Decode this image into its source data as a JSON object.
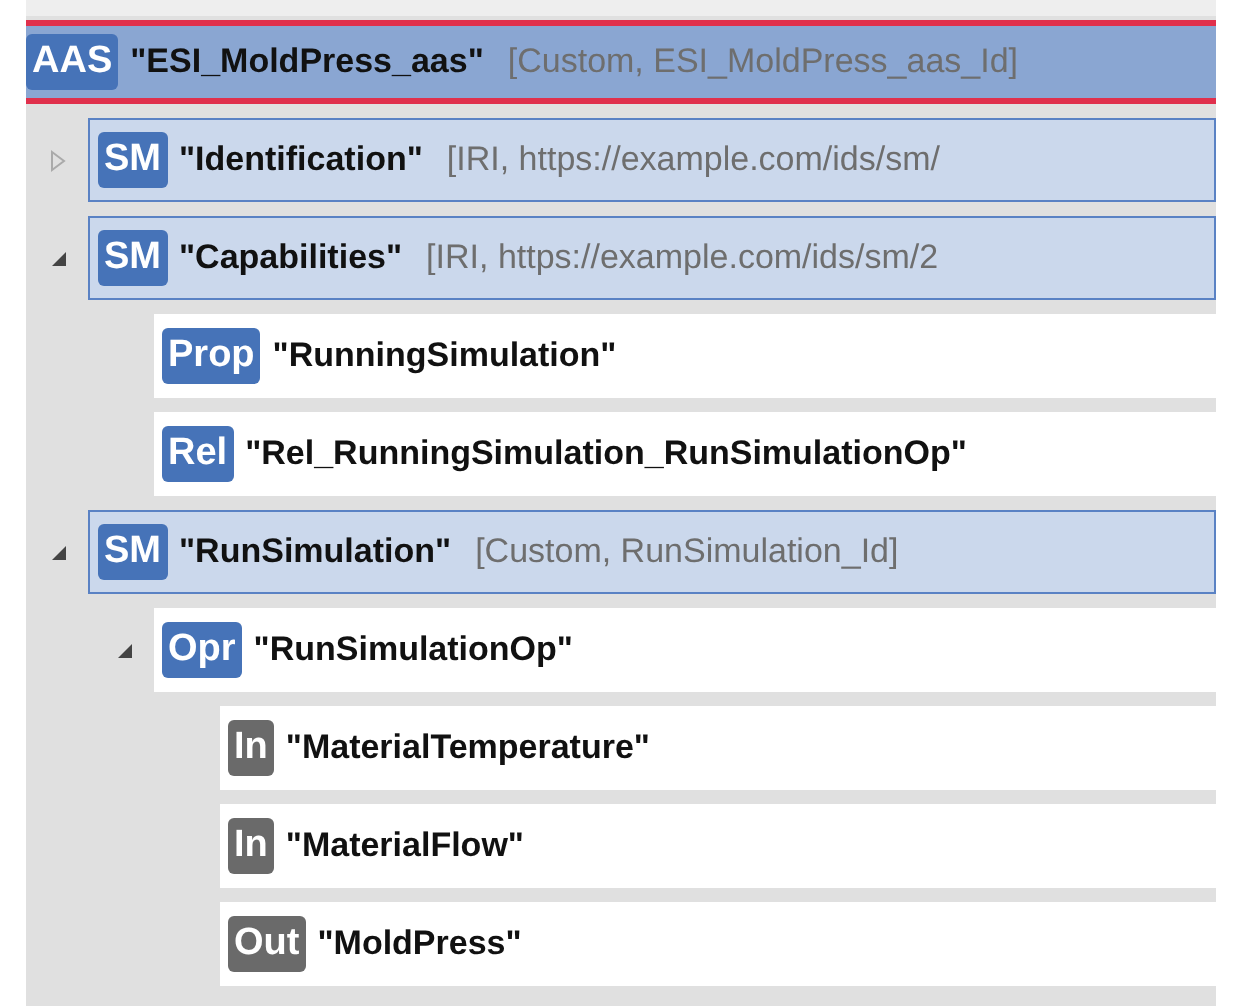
{
  "tree": [
    {
      "kind": "aas",
      "badge": "AAS",
      "name": "\"ESI_MoldPress_aas\"",
      "info": "[Custom, ESI_MoldPress_aas_Id]",
      "selected": true,
      "children": [
        {
          "kind": "submodel",
          "badge": "SM",
          "name": "\"Identification\"",
          "info": "[IRI, https://example.com/ids/sm/",
          "selected": false,
          "expanded": false
        },
        {
          "kind": "submodel",
          "badge": "SM",
          "name": "\"Capabilities\"",
          "info": "[IRI, https://example.com/ids/sm/2",
          "selected": false,
          "expanded": true,
          "children": [
            {
              "kind": "element",
              "badge": "Prop",
              "name": "\"RunningSimulation\"",
              "selected": false
            },
            {
              "kind": "element",
              "badge": "Rel",
              "name": "\"Rel_RunningSimulation_RunSimulationOp\"",
              "selected": false
            }
          ]
        },
        {
          "kind": "submodel",
          "badge": "SM",
          "name": "\"RunSimulation\"",
          "info": "[Custom, RunSimulation_Id]",
          "selected": false,
          "expanded": true,
          "children": [
            {
              "kind": "element",
              "badge": "Opr",
              "name": "\"RunSimulationOp\"",
              "selected": false,
              "expanded": true,
              "children": [
                {
                  "kind": "variable",
                  "badge": "In",
                  "name": "\"MaterialTemperature\"",
                  "selected": false
                },
                {
                  "kind": "variable",
                  "badge": "In",
                  "name": "\"MaterialFlow\"",
                  "selected": false
                },
                {
                  "kind": "variable",
                  "badge": "Out",
                  "name": "\"MoldPress\"",
                  "selected": false
                }
              ]
            }
          ]
        }
      ]
    }
  ]
}
